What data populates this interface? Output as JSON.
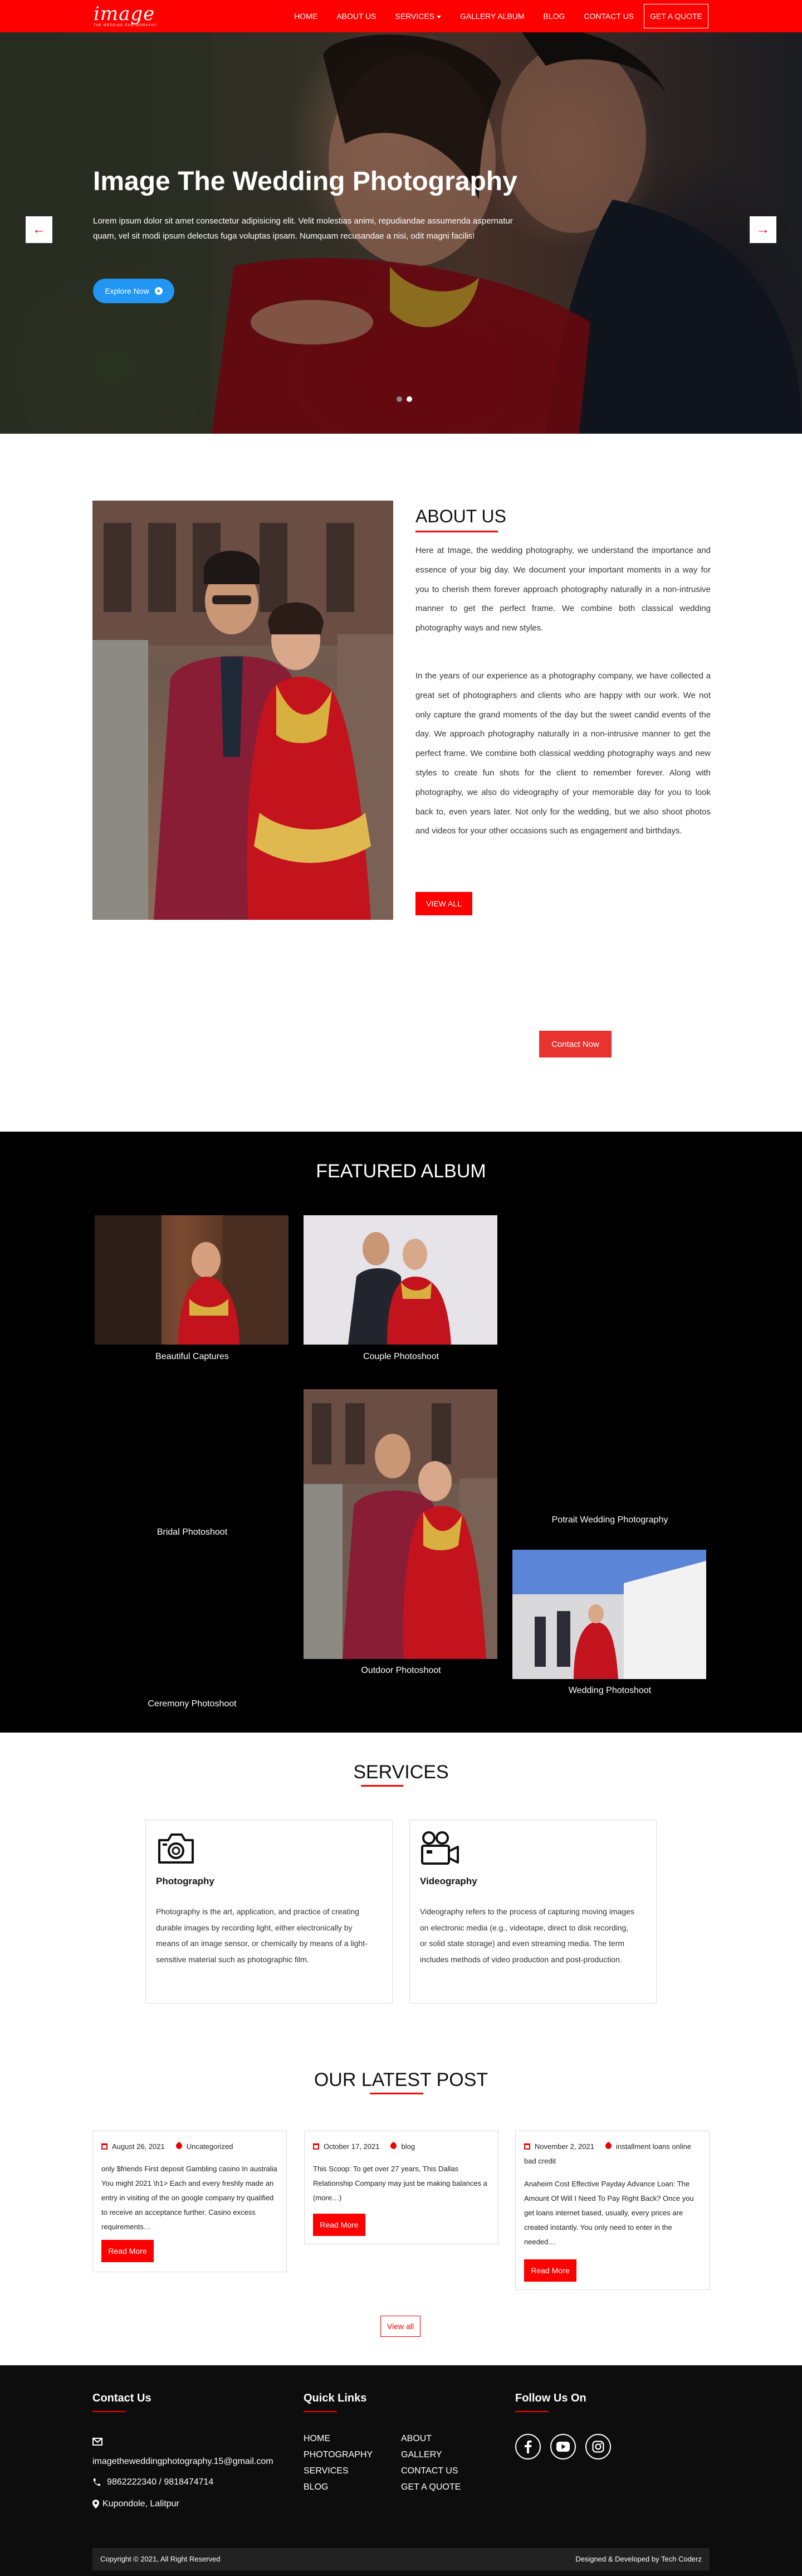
{
  "brand": {
    "name": "image",
    "tagline": "THE WEDDING PHOTOGRAPHY"
  },
  "nav": {
    "items": [
      "HOME",
      "ABOUT US",
      "SERVICES",
      "GALLERY ALBUM",
      "BLOG",
      "CONTACT US"
    ],
    "quote": "GET A QUOTE"
  },
  "hero": {
    "title": "Image The Wedding Photography",
    "text": "Lorem ipsum dolor sit amet consectetur adipisicing elit. Velit molestias animi, repudiandae assumenda aspernatur quam, vel sit modi ipsum delectus fuga voluptas ipsam. Numquam recusandae a nisi, odit magni facilis!",
    "button": "Explore Now",
    "prev": "←",
    "next": "→"
  },
  "about": {
    "title": "ABOUT US",
    "p1": "Here at Image, the wedding photography, we understand the importance and essence of your big day. We document your important moments in a way for you to cherish them forever approach photography naturally in a non-intrusive manner to get the perfect frame. We combine both classical wedding photography ways and new styles.",
    "p2": "In the years of our experience as a photography company, we have collected a great set of photographers and clients who are happy with our work. We not only capture the grand moments of the day but the sweet candid events of the day. We approach photography naturally in a non-intrusive manner to get the perfect frame. We combine both classical wedding photography ways and new styles to create fun shots for the client to remember forever. Along with photography, we also do videography of your memorable day for you to look back to, even years later. Not only for the wedding, but we also shoot photos and videos for your other occasions such as engagement and birthdays.",
    "button": "VIEW ALL",
    "contact": "Contact Now"
  },
  "featured": {
    "title": "FEATURED ALBUM",
    "albums": [
      "Beautiful Captures",
      "Couple Photoshoot",
      "Bridal Photoshoot",
      "Potrait Wedding Photography",
      "Outdoor Photoshoot",
      "Wedding Photoshoot",
      "Ceremony Photoshoot"
    ]
  },
  "services": {
    "title": "SERVICES",
    "items": [
      {
        "title": "Photography",
        "text": "Photography is the art, application, and practice of creating durable images by recording light, either electronically by means of an image sensor, or chemically by means of a light-sensitive material such as photographic film.",
        "icon": "camera-icon"
      },
      {
        "title": "Videography",
        "text": "Videography refers to the process of capturing moving images on electronic media (e.g., videotape, direct to disk recording, or solid state storage) and even streaming media. The term includes methods of video production and post-production.",
        "icon": "video-camera-icon"
      }
    ]
  },
  "posts": {
    "title": "OUR LATEST POST",
    "items": [
      {
        "date": "August 26, 2021",
        "category": "Uncategorized",
        "excerpt": "only $friends First deposit Gambling casino In australia You might 2021 \\h1> Each and every freshly made an entry in visiting of the on google company try qualified to receive an acceptance further. Casino excess requirements…",
        "button": "Read More"
      },
      {
        "date": "October 17, 2021",
        "category": "blog",
        "excerpt": "This Scoop: To get over 27 years, This Dallas Relationship Company may just be making balances a (more…)",
        "button": "Read More"
      },
      {
        "date": "November 2, 2021",
        "category": "installment loans online bad credit",
        "excerpt": "Anaheim Cost Effective Payday Advance Loan: The Amount Of Will I Need To Pay Right Back? Once you get loans internet based, usually, every prices are created instantly. You only need to enter in the needed…",
        "button": "Read More"
      }
    ],
    "view_all": "View all"
  },
  "footer": {
    "contact": {
      "title": "Contact Us",
      "email": "imagetheweddingphotography.15@gmail.com",
      "phone": "9862222340 / 9818474714",
      "address": "Kupondole, Lalitpur"
    },
    "links": {
      "title": "Quick Links",
      "col1": [
        "HOME",
        "PHOTOGRAPHY",
        "SERVICES",
        "BLOG"
      ],
      "col2": [
        "ABOUT",
        "GALLERY",
        "CONTACT US",
        "GET A QUOTE"
      ]
    },
    "follow": {
      "title": "Follow Us On",
      "icons": [
        "facebook-icon",
        "youtube-icon",
        "instagram-icon"
      ]
    },
    "copyright": "Copyright © 2021, All Right Reserved",
    "credit": "Designed & Developed by Tech Coderz"
  },
  "colors": {
    "accent": "#ff0000",
    "button_blue": "#2196f3",
    "dark": "#000000"
  }
}
